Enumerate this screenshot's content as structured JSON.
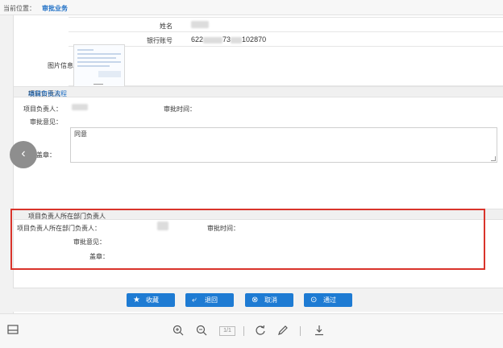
{
  "breadcrumb": {
    "location_label": "当前位置：",
    "current": "审批业务"
  },
  "info": {
    "name_label": "姓名",
    "bank_label": "银行账号",
    "bank_prefix": "622",
    "bank_mid": "73",
    "bank_suffix": "102870",
    "image_label": "图片信息"
  },
  "section1": {
    "title": "项目负责人",
    "edit_link": "编辑审批流程",
    "leader_label": "项目负责人：",
    "time_label": "审批时间：",
    "opinion_label": "审批意见：",
    "opinion_value": "同意",
    "seal_label": "盖章："
  },
  "section2": {
    "title": "项目负责人所在部门负责人",
    "leader_label": "项目负责人所在部门负责人：",
    "time_label": "审批时间：",
    "opinion_label": "审批意见：",
    "seal_label": "盖章："
  },
  "buttons": {
    "favorite": "收藏",
    "reject": "退回",
    "cancel": "取消",
    "approve": "通过"
  },
  "viewer": {
    "page": "1/1"
  },
  "icons": {
    "back": "chevron-left-icon",
    "sidebar": "sidebar-toggle-icon",
    "zoom_in": "zoom-in-icon",
    "zoom_out": "zoom-out-icon",
    "rotate": "rotate-icon",
    "edit": "pencil-icon",
    "download": "download-icon"
  },
  "colors": {
    "accent": "#1e7bd3",
    "highlight": "#d9342b"
  }
}
